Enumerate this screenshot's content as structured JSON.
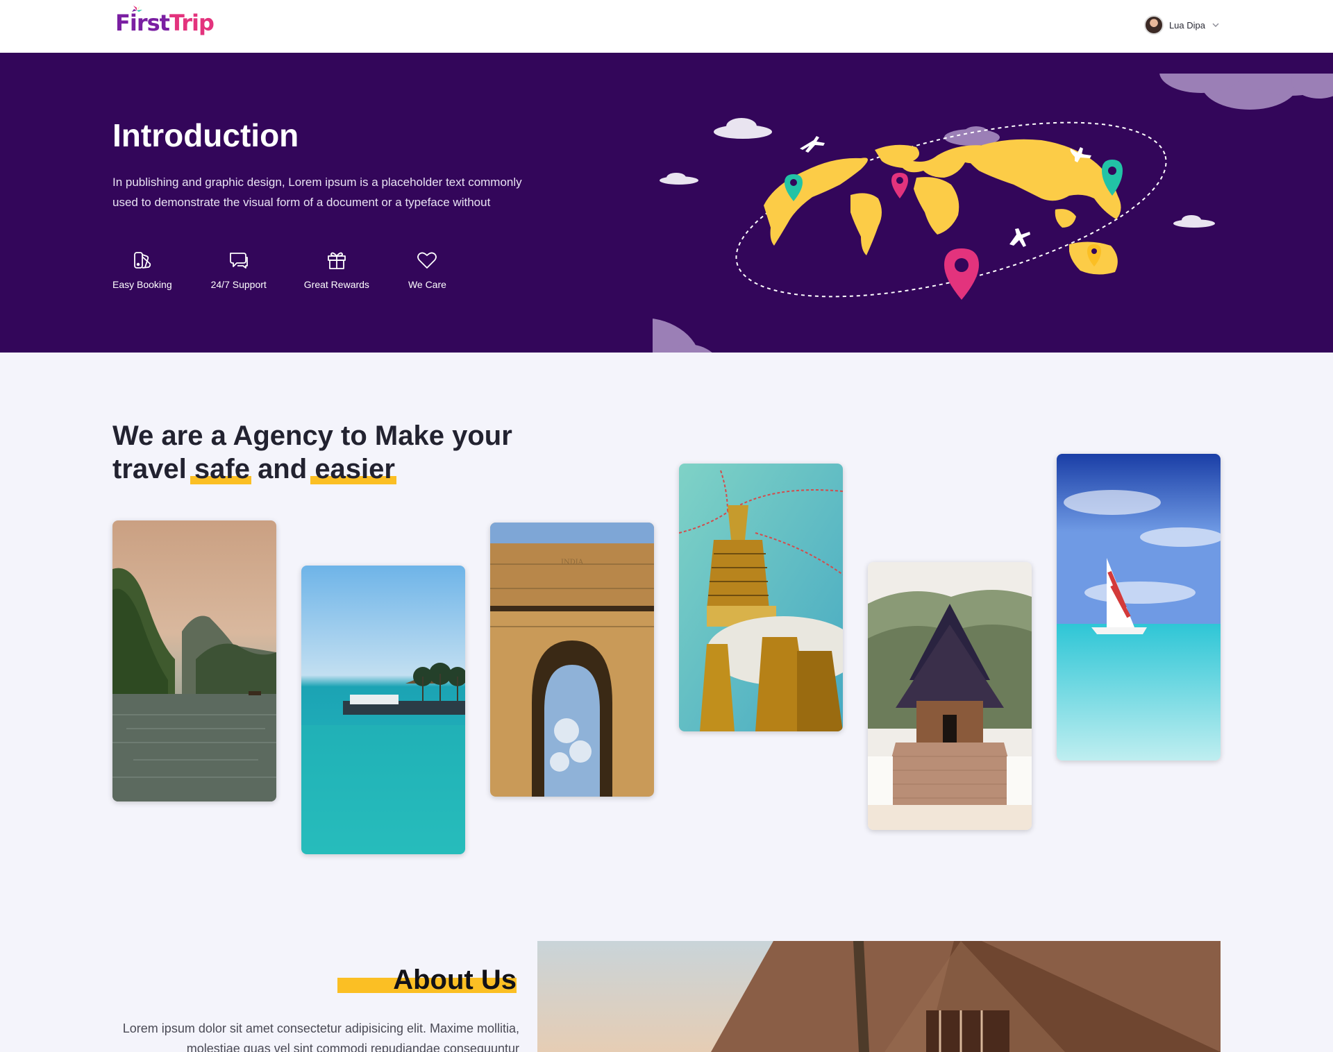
{
  "header": {
    "logo_first": "First",
    "logo_trip": "Trip",
    "user_name": "Lua Dipa"
  },
  "hero": {
    "title": "Introduction",
    "description": "In publishing and graphic design, Lorem ipsum is a placeholder text commonly used to demonstrate the visual form of a document or a typeface without",
    "features": [
      {
        "label": "Easy Booking",
        "icon": "booking-icon"
      },
      {
        "label": "24/7 Support",
        "icon": "chat-icon"
      },
      {
        "label": "Great Rewards",
        "icon": "gift-icon"
      },
      {
        "label": "We Care",
        "icon": "heart-icon"
      }
    ]
  },
  "agency": {
    "title_line1": "We are a Agency to Make your",
    "title_travel": "travel",
    "title_safe": "safe",
    "title_and": "and",
    "title_easier": "easier",
    "photos": [
      "river-valley-photo",
      "maldives-pier-photo",
      "india-gate-photo",
      "stupa-photo",
      "thai-temple-photo",
      "sailboat-photo"
    ]
  },
  "about": {
    "title": "About Us",
    "text": "Lorem ipsum dolor sit amet consectetur adipisicing elit. Maxime mollitia, molestiae quas vel sint commodi repudiandae consequuntur"
  },
  "colors": {
    "hero_bg": "#33065a",
    "accent_yellow": "#fbbf24",
    "brand_purple": "#7a1fa2",
    "brand_pink": "#e3337d",
    "page_bg": "#f4f4fb"
  }
}
